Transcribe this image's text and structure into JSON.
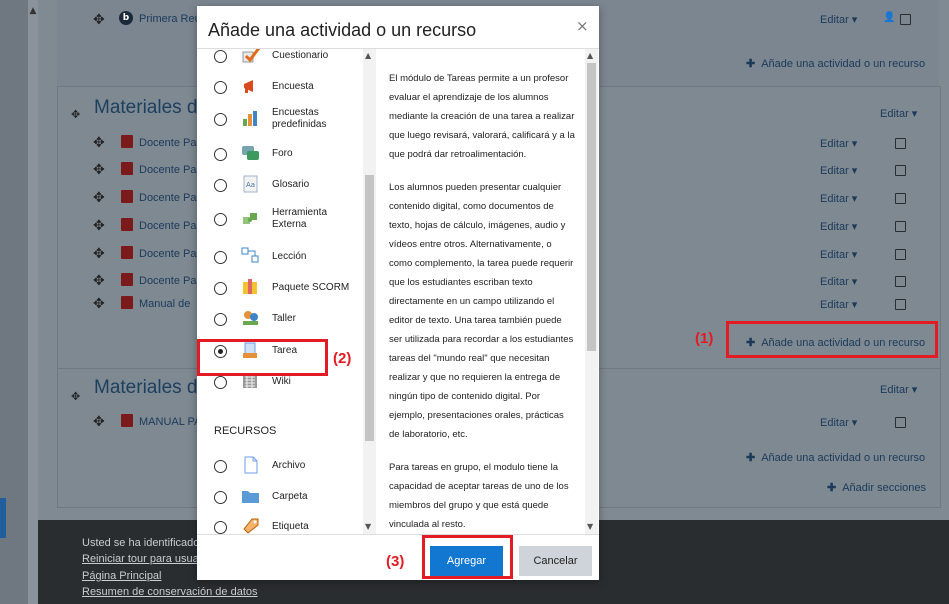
{
  "course": {
    "top_item_label": "Primera Reu",
    "top_item_editar": "Editar ▾",
    "add_activity_label": "Añade una actividad o un recurso",
    "section1": {
      "title": "Materiales de",
      "editar": "Editar ▾",
      "items": [
        {
          "label": "Docente Pa",
          "editar": "Editar ▾"
        },
        {
          "label": "Docente Pa",
          "editar": "Editar ▾"
        },
        {
          "label": "Docente Pa",
          "editar": "Editar ▾"
        },
        {
          "label": "Docente Pa",
          "editar": "Editar ▾"
        },
        {
          "label": "Docente Pa",
          "editar": "Editar ▾"
        },
        {
          "label": "Docente Pa",
          "editar": "Editar ▾"
        },
        {
          "label": "Manual de",
          "editar": "Editar ▾"
        }
      ]
    },
    "section2": {
      "title": "Materiales d",
      "editar": "Editar ▾",
      "items": [
        {
          "label": "MANUAL PA",
          "editar": "Editar ▾"
        }
      ]
    },
    "add_sections_label": "Añadir secciones"
  },
  "footer": {
    "line1": "Usted se ha identificado",
    "line2": "Reiniciar tour para usua",
    "line3": "Página Principal",
    "line4": "Resumen de conservación de datos"
  },
  "annotations": {
    "label1": "(1)",
    "label2": "(2)",
    "label3": "(3)",
    "color": "#e31b23"
  },
  "modal": {
    "title": "Añade una actividad o un recurso",
    "close": "×",
    "items": [
      {
        "label": "Cuestionario",
        "icon": "quiz-icon"
      },
      {
        "label": "Encuesta",
        "icon": "megaphone-icon"
      },
      {
        "label": "Encuestas predefinidas",
        "icon": "bar-chart-icon"
      },
      {
        "label": "Foro",
        "icon": "forum-icon"
      },
      {
        "label": "Glosario",
        "icon": "glossary-icon"
      },
      {
        "label": "Herramienta Externa",
        "icon": "puzzle-icon"
      },
      {
        "label": "Lección",
        "icon": "lesson-icon"
      },
      {
        "label": "Paquete SCORM",
        "icon": "scorm-icon"
      },
      {
        "label": "Taller",
        "icon": "workshop-icon"
      },
      {
        "label": "Tarea",
        "icon": "assignment-icon",
        "selected": true
      },
      {
        "label": "Wiki",
        "icon": "wiki-icon"
      }
    ],
    "resources_heading": "RECURSOS",
    "resources": [
      {
        "label": "Archivo",
        "icon": "file-icon"
      },
      {
        "label": "Carpeta",
        "icon": "folder-icon"
      },
      {
        "label": "Etiqueta",
        "icon": "label-icon"
      }
    ],
    "description": [
      "El módulo de Tareas permite a un profesor evaluar el aprendizaje de los alumnos mediante la creación de una tarea a realizar que luego revisará, valorará, calificará y a la que podrá dar retroalimentación.",
      "Los alumnos pueden presentar cualquier contenido digital, como documentos de texto, hojas de cálculo, imágenes, audio y vídeos entre otros. Alternativamente, o como complemento, la tarea puede requerir que los estudiantes escriban texto directamente en un campo utilizando el editor de texto. Una tarea también puede ser utilizada para recordar a los estudiantes tareas del \"mundo real\" que necesitan realizar y que no requieren la entrega de ningún tipo de contenido digital. Por ejemplo, presentaciones orales, prácticas de laboratorio, etc.",
      "Para tareas en grupo, el modulo tiene la capacidad de aceptar tareas de uno de los miembros del grupo y que está quede vinculada al resto."
    ],
    "primary_button": "Agregar",
    "cancel_button": "Cancelar"
  }
}
